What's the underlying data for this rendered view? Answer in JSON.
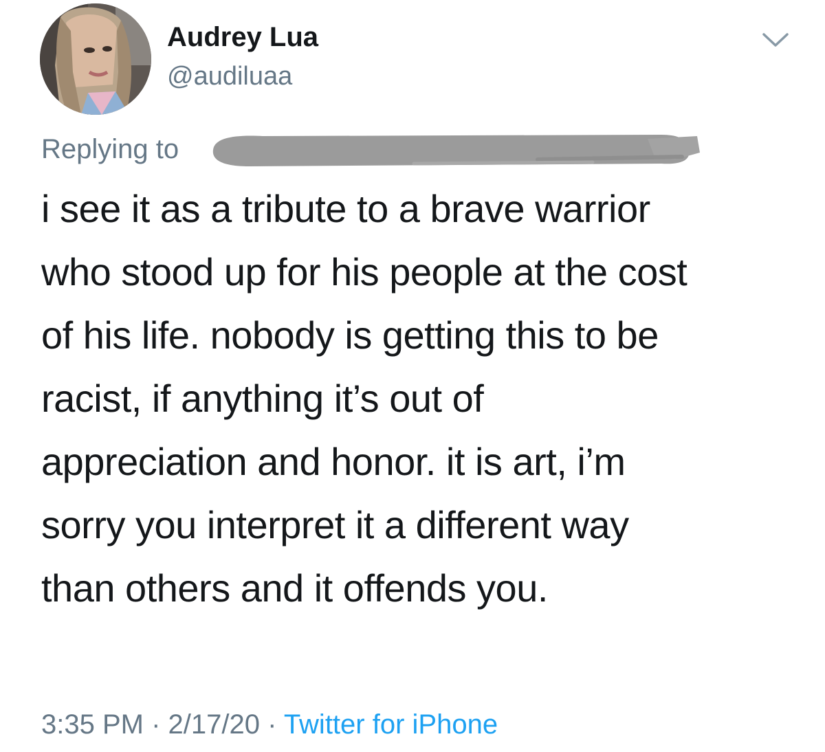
{
  "author": {
    "display_name": "Audrey Lua",
    "handle": "@audiluaa"
  },
  "reply": {
    "label": "Replying to"
  },
  "tweet": {
    "text": "i see it as a tribute to a brave warrior\nwho stood up for his people at the cost\nof his life. nobody is getting this to be\nracist, if anything it’s out of\nappreciation and honor. it is art, i’m\nsorry you interpret it a different way\nthan others and it offends you."
  },
  "meta": {
    "time": "3:35 PM",
    "separator": " · ",
    "date": "2/17/20",
    "source": "Twitter for iPhone"
  },
  "icons": {
    "menu": "chevron-down-icon"
  },
  "colors": {
    "primary_text": "#14171a",
    "secondary_text": "#657786",
    "link": "#1da1f2",
    "redaction": "#9b9b9b"
  }
}
